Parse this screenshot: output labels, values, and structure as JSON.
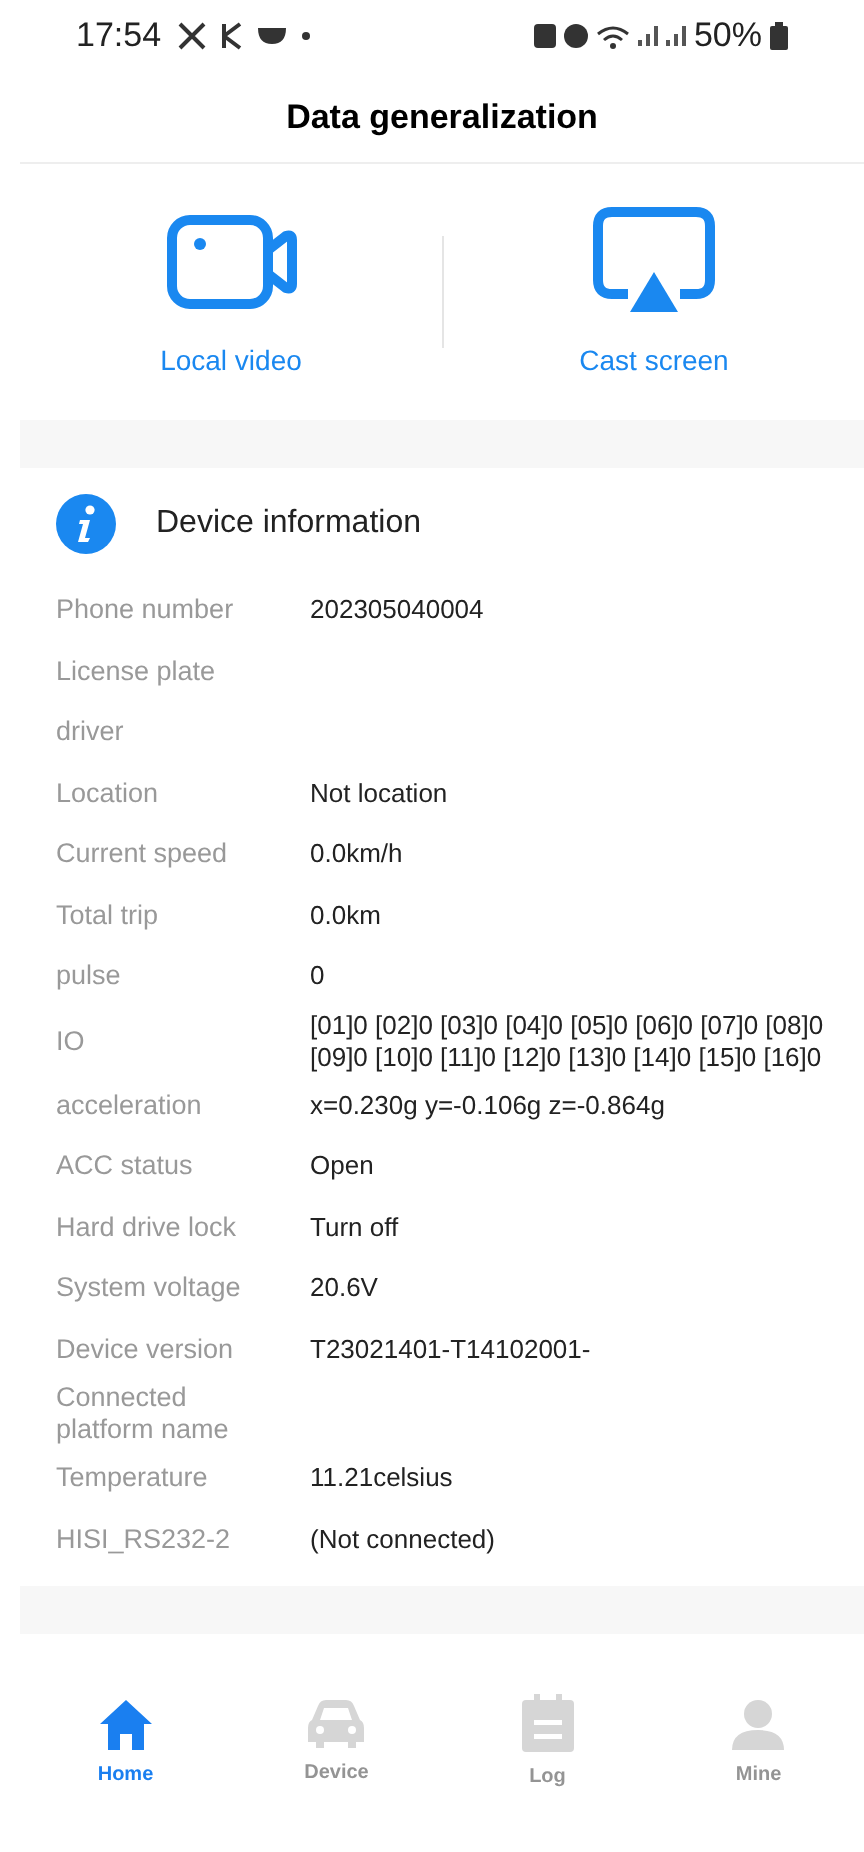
{
  "status_bar": {
    "time": "17:54",
    "battery": "50%"
  },
  "header": {
    "title": "Data generalization"
  },
  "actions": [
    {
      "kind": "video",
      "label": "Local video"
    },
    {
      "kind": "cast",
      "label": "Cast screen"
    }
  ],
  "device_info": {
    "title": "Device information",
    "rows": [
      {
        "label": "Phone number",
        "value": "202305040004"
      },
      {
        "label": "License plate"
      },
      {
        "label": "driver"
      },
      {
        "label": "Location",
        "value": "Not location"
      },
      {
        "label": "Current speed",
        "value": "0.0km/h"
      },
      {
        "label": "Total trip",
        "value": "0.0km"
      },
      {
        "label": "pulse",
        "value": "0"
      },
      {
        "label": "IO",
        "value": "[01]0 [02]0 [03]0 [04]0 [05]0 [06]0 [07]0 [08]0 [09]0 [10]0 [11]0 [12]0 [13]0 [14]0 [15]0 [16]0"
      },
      {
        "label": "acceleration",
        "value": "x=0.230g y=-0.106g z=-0.864g"
      },
      {
        "label": "ACC status",
        "value": "Open"
      },
      {
        "label": "Hard drive lock",
        "value": "Turn off"
      },
      {
        "label": "System voltage",
        "value": "20.6V"
      },
      {
        "label": "Device version",
        "value": "T23021401-T14102001-"
      },
      {
        "label": "Connected platform name"
      },
      {
        "label": "Temperature",
        "value": "11.21celsius"
      },
      {
        "label": "HISI_RS232-2",
        "value": "(Not connected)"
      }
    ]
  },
  "tab_bar": [
    {
      "kind": "home",
      "label": "Home",
      "selected": true
    },
    {
      "kind": "car",
      "label": "Device",
      "selected": false
    },
    {
      "kind": "log",
      "label": "Log",
      "selected": false
    },
    {
      "kind": "person",
      "label": "Mine",
      "selected": false
    }
  ]
}
